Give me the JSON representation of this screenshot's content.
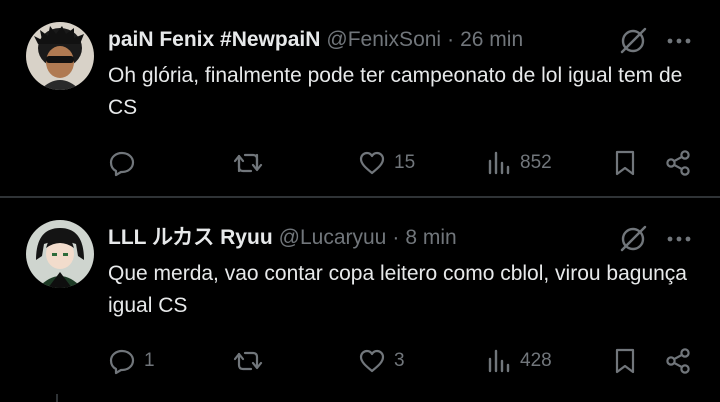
{
  "tweets": [
    {
      "author_name": "paiN Fenix #NewpaiN",
      "handle": "@FenixSoni",
      "separator": "·",
      "time": "26 min",
      "text": "Oh glória, finalmente pode ter campeonato de lol igual tem de CS",
      "replies": "",
      "retweets": "",
      "likes": "15",
      "views": "852"
    },
    {
      "author_name": "LLL ルカス Ryuu",
      "handle": "@Lucaryuu",
      "separator": "·",
      "time": "8 min",
      "text": "Que merda, vao contar copa leitero como cblol, virou bagunça igual CS",
      "replies": "1",
      "retweets": "",
      "likes": "3",
      "views": "428"
    }
  ],
  "colors": {
    "background": "#000000",
    "text_primary": "#e7e9ea",
    "text_secondary": "#71767b",
    "divider": "#2f3336"
  },
  "icons": [
    "reply-icon",
    "retweet-icon",
    "like-icon",
    "views-icon",
    "bookmark-icon",
    "share-icon",
    "grok-icon",
    "more-icon"
  ]
}
